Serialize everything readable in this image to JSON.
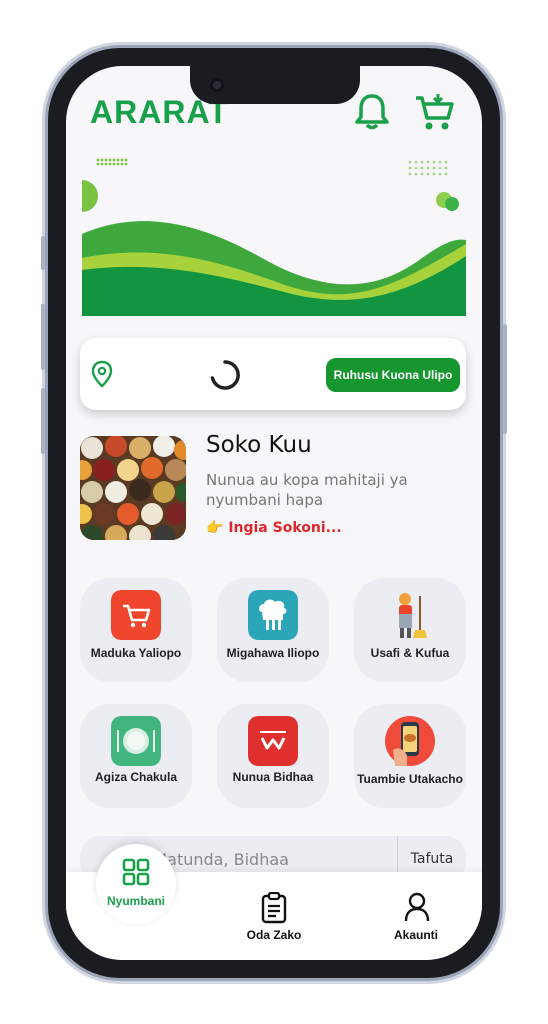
{
  "header": {
    "logo": "ARARAT",
    "notification_icon": "bell-icon",
    "cart_icon": "cart-icon",
    "brand_color": "#19a04b"
  },
  "location": {
    "icon": "map-pin-icon",
    "loading_icon": "spinner-icon",
    "allow_button_label": "Ruhusu Kuona Ulipo"
  },
  "market": {
    "title": "Soko Kuu",
    "description": "Nunua au kopa mahitaji ya nyumbani hapa",
    "link_label": "Ingia Sokoni...",
    "link_icon": "pointing-hand-icon",
    "link_color": "#e0262d"
  },
  "services": [
    {
      "label": "Maduka Yaliopo",
      "icon": "shop-cart-icon"
    },
    {
      "label": "Migahawa Iliopo",
      "icon": "restaurant-icon"
    },
    {
      "label": "Usafi & Kufua",
      "icon": "cleaner-icon"
    },
    {
      "label": "Agiza Chakula",
      "icon": "food-plate-icon"
    },
    {
      "label": "Nunua Bidhaa",
      "icon": "shopping-bag-icon"
    },
    {
      "label": "Tuambie Utakacho",
      "icon": "phone-order-icon"
    }
  ],
  "search": {
    "placeholder": "kula, Matunda, Bidhaa",
    "button_label": "Tafuta"
  },
  "tabs": [
    {
      "label": "Nyumbani",
      "icon": "home-grid-icon",
      "active": true
    },
    {
      "label": "Oda Zako",
      "icon": "clipboard-icon",
      "active": false
    },
    {
      "label": "Akaunti",
      "icon": "user-icon",
      "active": false
    }
  ]
}
